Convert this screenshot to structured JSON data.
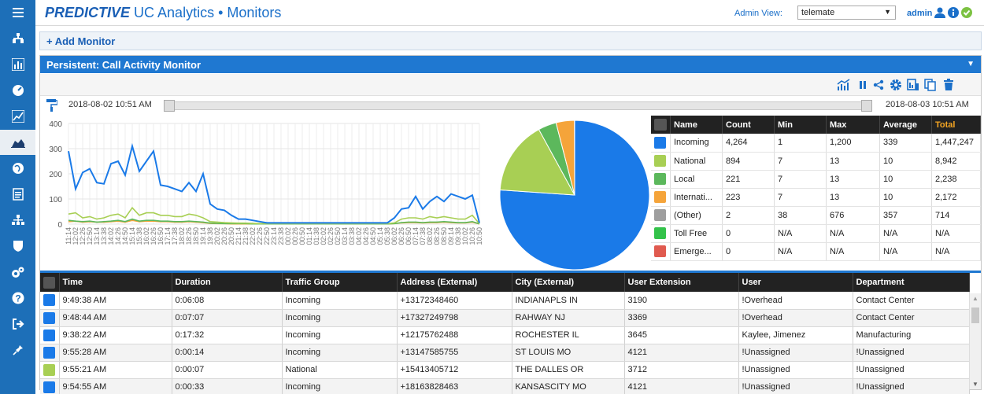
{
  "header": {
    "brand": "PREDICTIVE",
    "brand_rest": " UC Analytics",
    "sep": " • ",
    "section": "Monitors",
    "admin_view_label": "Admin View:",
    "admin_view_value": "telemate",
    "user": "admin"
  },
  "add_monitor": "+ Add Monitor",
  "panel": {
    "title": "Persistent: Call Activity Monitor",
    "start_time": "2018-08-02 10:51 AM",
    "end_time": "2018-08-03 10:51 AM"
  },
  "colors": {
    "incoming": "#1a7ae8",
    "national": "#a8cf54",
    "local": "#5cb85c",
    "international": "#f5a43a",
    "other": "#9e9e9e",
    "tollfree": "#33c24a",
    "emergency": "#e05a4f"
  },
  "summary": {
    "headers": [
      "Name",
      "Count",
      "Min",
      "Max",
      "Average",
      "Total"
    ],
    "rows": [
      {
        "name": "Incoming",
        "count": "4,264",
        "min": "1",
        "max": "1,200",
        "avg": "339",
        "total": "1,447,247"
      },
      {
        "name": "National",
        "count": "894",
        "min": "7",
        "max": "13",
        "avg": "10",
        "total": "8,942"
      },
      {
        "name": "Local",
        "count": "221",
        "min": "7",
        "max": "13",
        "avg": "10",
        "total": "2,238"
      },
      {
        "name": "Internati...",
        "count": "223",
        "min": "7",
        "max": "13",
        "avg": "10",
        "total": "2,172"
      },
      {
        "name": "(Other)",
        "count": "2",
        "min": "38",
        "max": "676",
        "avg": "357",
        "total": "714"
      },
      {
        "name": "Toll Free",
        "count": "0",
        "min": "N/A",
        "max": "N/A",
        "avg": "N/A",
        "total": "N/A"
      },
      {
        "name": "Emerge...",
        "count": "0",
        "min": "N/A",
        "max": "N/A",
        "avg": "N/A",
        "total": "N/A"
      }
    ]
  },
  "calls": {
    "headers": [
      "Time",
      "Duration",
      "Traffic Group",
      "Address (External)",
      "City (External)",
      "User Extension",
      "User",
      "Department"
    ],
    "rows": [
      {
        "color": "incoming",
        "time": "9:49:38 AM",
        "duration": "0:06:08",
        "group": "Incoming",
        "address": "+13172348460",
        "city": "INDIANAPLS IN",
        "ext": "3190",
        "user": "!Overhead",
        "dept": "Contact Center"
      },
      {
        "color": "incoming",
        "time": "9:48:44 AM",
        "duration": "0:07:07",
        "group": "Incoming",
        "address": "+17327249798",
        "city": "RAHWAY NJ",
        "ext": "3369",
        "user": "!Overhead",
        "dept": "Contact Center"
      },
      {
        "color": "incoming",
        "time": "9:38:22 AM",
        "duration": "0:17:32",
        "group": "Incoming",
        "address": "+12175762488",
        "city": "ROCHESTER IL",
        "ext": "3645",
        "user": "Kaylee, Jimenez",
        "dept": "Manufacturing"
      },
      {
        "color": "incoming",
        "time": "9:55:28 AM",
        "duration": "0:00:14",
        "group": "Incoming",
        "address": "+13147585755",
        "city": "ST LOUIS MO",
        "ext": "4121",
        "user": "!Unassigned",
        "dept": "!Unassigned"
      },
      {
        "color": "national",
        "time": "9:55:21 AM",
        "duration": "0:00:07",
        "group": "National",
        "address": "+15413405712",
        "city": "THE DALLES OR",
        "ext": "3712",
        "user": "!Unassigned",
        "dept": "!Unassigned"
      },
      {
        "color": "incoming",
        "time": "9:54:55 AM",
        "duration": "0:00:33",
        "group": "Incoming",
        "address": "+18163828463",
        "city": "KANSASCITY MO",
        "ext": "4121",
        "user": "!Unassigned",
        "dept": "!Unassigned"
      }
    ]
  },
  "chart_data": [
    {
      "type": "line",
      "ylim": [
        0,
        400
      ],
      "yticks": [
        0,
        100,
        200,
        300,
        400
      ],
      "x": [
        "11:14",
        "12:02",
        "12:26",
        "12:50",
        "13:14",
        "13:38",
        "14:02",
        "14:26",
        "14:50",
        "15:14",
        "15:38",
        "16:02",
        "16:26",
        "16:50",
        "17:14",
        "17:38",
        "18:02",
        "18:26",
        "18:50",
        "19:14",
        "19:38",
        "20:02",
        "20:26",
        "20:50",
        "21:14",
        "21:38",
        "22:02",
        "22:26",
        "22:50",
        "23:14",
        "23:38",
        "00:02",
        "00:26",
        "00:50",
        "01:14",
        "01:38",
        "02:02",
        "02:26",
        "02:50",
        "03:14",
        "03:38",
        "04:02",
        "04:26",
        "04:50",
        "05:14",
        "05:38",
        "06:02",
        "06:26",
        "06:50",
        "07:14",
        "07:38",
        "08:02",
        "08:26",
        "08:50",
        "09:14",
        "09:38",
        "10:02",
        "10:26",
        "10:50"
      ],
      "series": [
        {
          "color": "incoming",
          "values": [
            290,
            140,
            205,
            220,
            165,
            160,
            240,
            250,
            195,
            310,
            210,
            250,
            290,
            155,
            150,
            140,
            130,
            165,
            130,
            200,
            80,
            60,
            55,
            35,
            20,
            20,
            15,
            10,
            5,
            5,
            5,
            5,
            5,
            5,
            5,
            5,
            5,
            5,
            5,
            5,
            5,
            5,
            5,
            5,
            5,
            5,
            25,
            60,
            65,
            110,
            60,
            90,
            110,
            90,
            120,
            110,
            100,
            115,
            5
          ]
        },
        {
          "color": "national",
          "values": [
            40,
            45,
            25,
            30,
            20,
            25,
            35,
            40,
            25,
            65,
            35,
            45,
            45,
            35,
            35,
            30,
            30,
            40,
            35,
            25,
            10,
            8,
            6,
            5,
            4,
            4,
            3,
            2,
            2,
            2,
            2,
            2,
            2,
            2,
            2,
            2,
            2,
            2,
            2,
            2,
            2,
            2,
            2,
            2,
            2,
            2,
            5,
            20,
            25,
            25,
            20,
            30,
            25,
            30,
            25,
            20,
            20,
            35,
            2
          ]
        },
        {
          "color": "local",
          "values": [
            15,
            12,
            10,
            12,
            8,
            10,
            12,
            15,
            10,
            20,
            12,
            15,
            15,
            12,
            12,
            10,
            10,
            12,
            10,
            8,
            4,
            3,
            2,
            2,
            2,
            2,
            1,
            1,
            1,
            1,
            1,
            1,
            1,
            1,
            1,
            1,
            1,
            1,
            1,
            1,
            1,
            1,
            1,
            1,
            1,
            1,
            2,
            6,
            8,
            8,
            6,
            8,
            8,
            10,
            8,
            6,
            6,
            10,
            1
          ]
        },
        {
          "color": "international",
          "values": [
            10,
            12,
            8,
            10,
            8,
            8,
            10,
            12,
            8,
            15,
            10,
            12,
            12,
            10,
            10,
            8,
            8,
            10,
            8,
            6,
            3,
            2,
            2,
            1,
            1,
            1,
            1,
            1,
            1,
            1,
            1,
            1,
            1,
            1,
            1,
            1,
            1,
            1,
            1,
            1,
            1,
            1,
            1,
            1,
            1,
            1,
            2,
            5,
            6,
            6,
            5,
            6,
            6,
            8,
            6,
            5,
            5,
            8,
            1
          ]
        }
      ]
    },
    {
      "type": "pie",
      "slices": [
        {
          "color": "incoming",
          "value": 4264
        },
        {
          "color": "national",
          "value": 894
        },
        {
          "color": "local",
          "value": 221
        },
        {
          "color": "international",
          "value": 223
        },
        {
          "color": "other",
          "value": 2
        }
      ]
    }
  ]
}
